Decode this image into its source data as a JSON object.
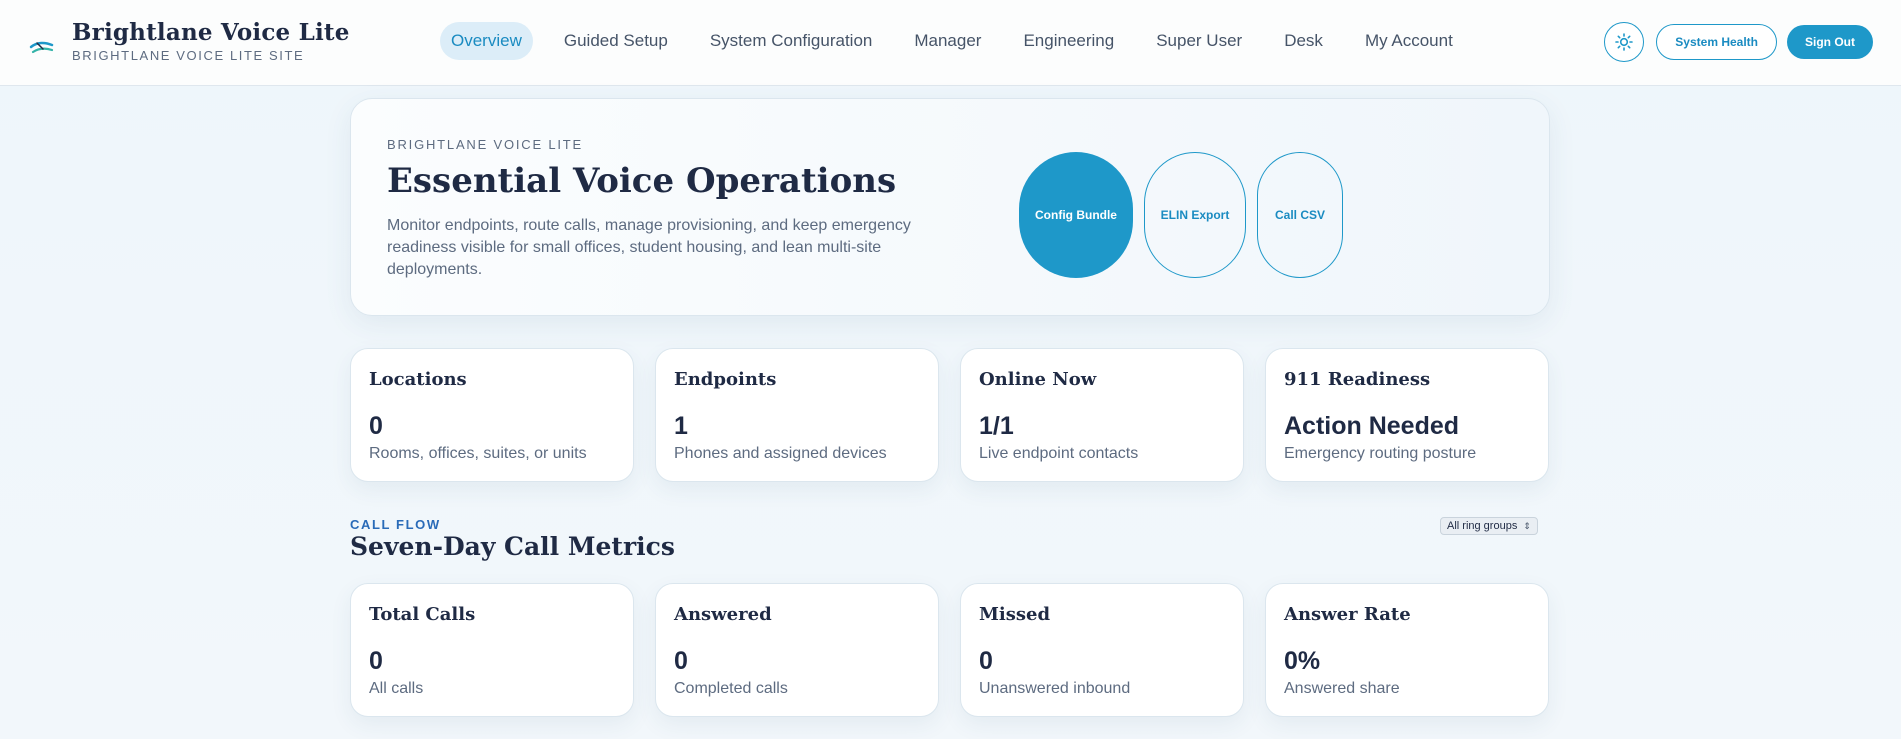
{
  "brand": {
    "title": "Brightlane Voice Lite",
    "subtitle": "BRIGHTLANE VOICE LITE SITE"
  },
  "nav": {
    "items": [
      {
        "label": "Overview",
        "active": true
      },
      {
        "label": "Guided Setup"
      },
      {
        "label": "System Configuration"
      },
      {
        "label": "Manager"
      },
      {
        "label": "Engineering"
      },
      {
        "label": "Super User"
      },
      {
        "label": "Desk"
      },
      {
        "label": "My Account"
      }
    ]
  },
  "top_actions": {
    "theme_icon": "sun-icon",
    "system_health": "System Health",
    "sign_out": "Sign Out"
  },
  "hero": {
    "eyebrow": "BRIGHTLANE VOICE LITE",
    "title": "Essential Voice Operations",
    "description": "Monitor endpoints, route calls, manage provisioning, and keep emergency readiness visible for small offices, student housing, and lean multi-site deployments.",
    "actions": [
      "Config Bundle",
      "ELIN Export",
      "Call CSV"
    ]
  },
  "summary_cards": [
    {
      "title": "Locations",
      "value": "0",
      "sub": "Rooms, offices, suites, or units"
    },
    {
      "title": "Endpoints",
      "value": "1",
      "sub": "Phones and assigned devices"
    },
    {
      "title": "Online Now",
      "value": "1/1",
      "sub": "Live endpoint contacts"
    },
    {
      "title": "911 Readiness",
      "value": "Action Needed",
      "sub": "Emergency routing posture"
    }
  ],
  "call_flow": {
    "eyebrow": "CALL FLOW",
    "title": "Seven-Day Call Metrics",
    "ring_group_select": "All ring groups",
    "cards": [
      {
        "title": "Total Calls",
        "value": "0",
        "sub": "All calls"
      },
      {
        "title": "Answered",
        "value": "0",
        "sub": "Completed calls"
      },
      {
        "title": "Missed",
        "value": "0",
        "sub": "Unanswered inbound"
      },
      {
        "title": "Answer Rate",
        "value": "0%",
        "sub": "Answered share"
      }
    ]
  },
  "colors": {
    "accent": "#1e98c9",
    "text": "#1f2a44",
    "muted": "#5d6b80",
    "eyebrow_blue": "#2a6bb8"
  }
}
